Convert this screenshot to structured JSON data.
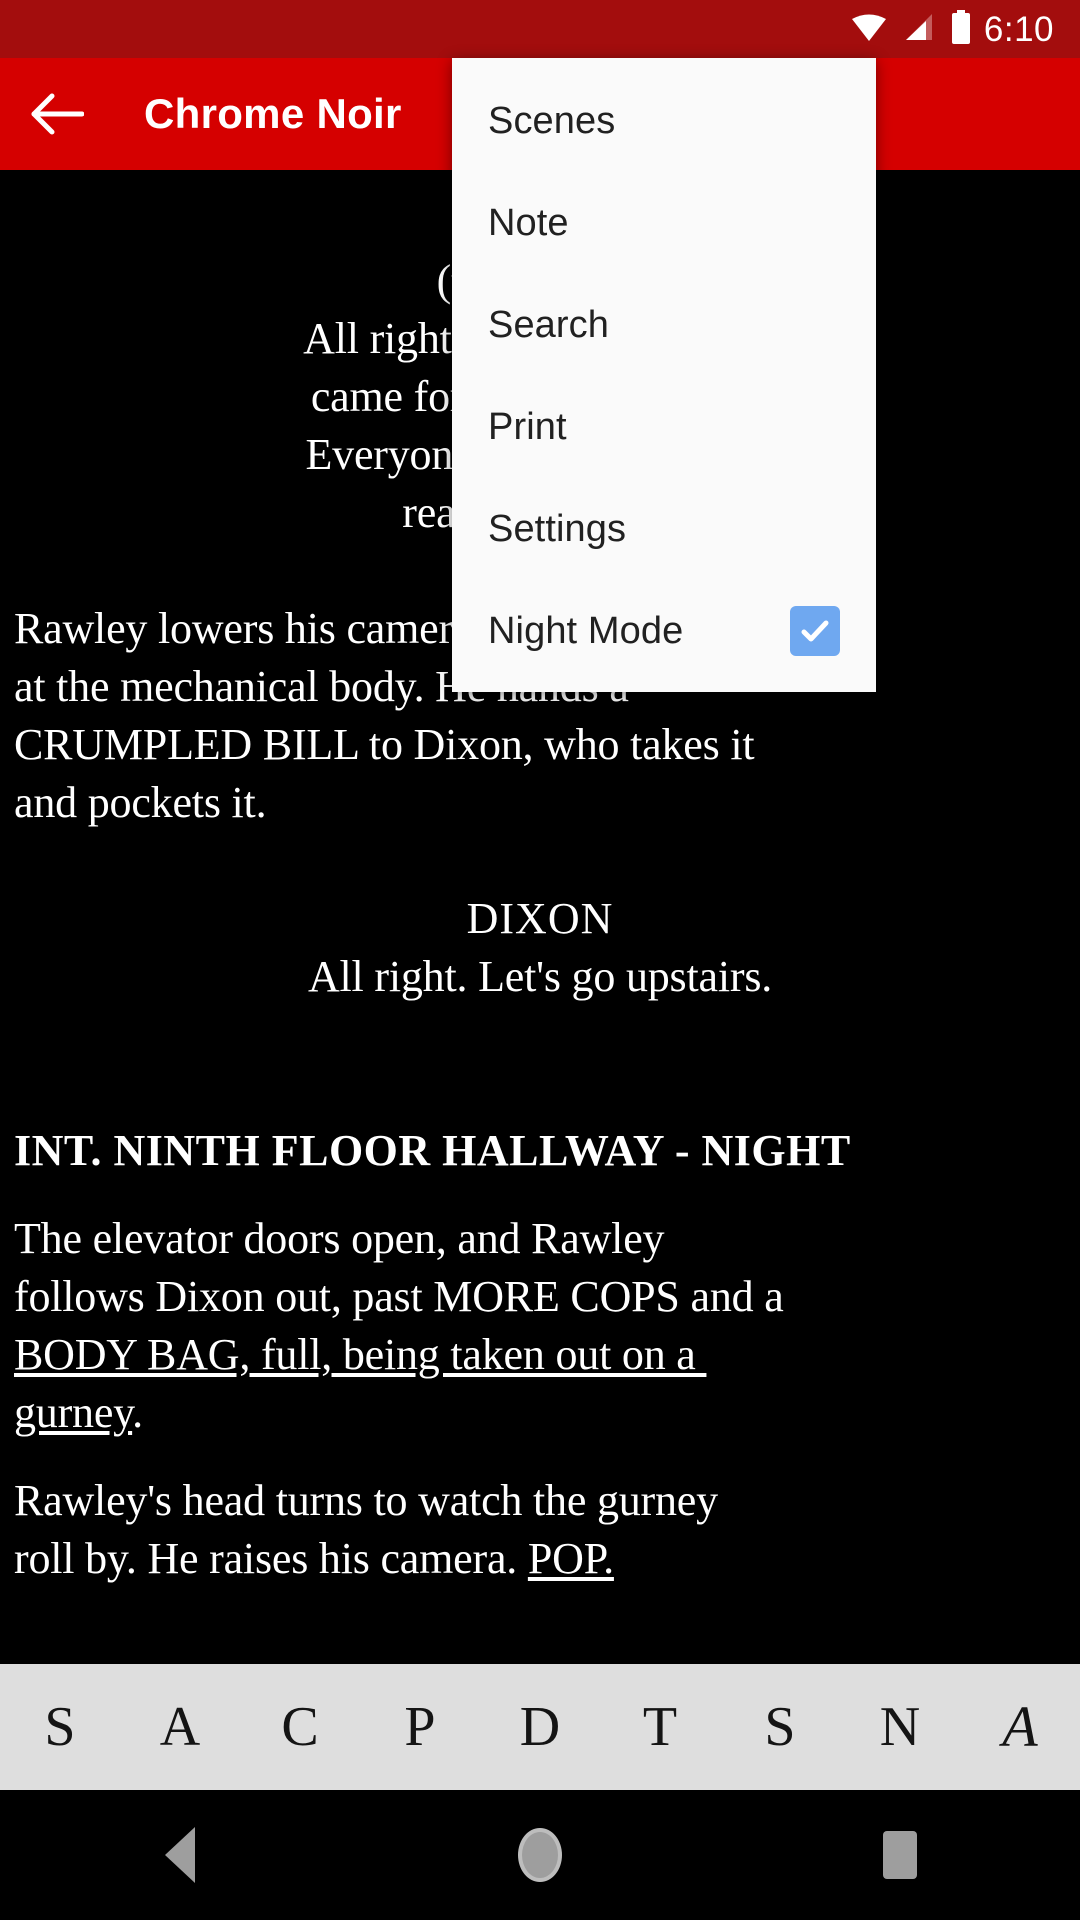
{
  "status_bar": {
    "clock": "6:10",
    "icons": [
      "wifi-icon",
      "signal-icon",
      "battery-icon"
    ],
    "background": "#a30d0d"
  },
  "app_bar": {
    "back_icon": "arrow-left-icon",
    "title": "Chrome Noir",
    "background": "#d50000",
    "title_color": "#ffffff"
  },
  "menu": {
    "background": "#fafafa",
    "text_color": "#212121",
    "items": [
      {
        "label": "Scenes",
        "type": "item",
        "checked": null
      },
      {
        "label": "Note",
        "type": "item",
        "checked": null
      },
      {
        "label": "Search",
        "type": "item",
        "checked": null
      },
      {
        "label": "Print",
        "type": "item",
        "checked": null
      },
      {
        "label": "Settings",
        "type": "item",
        "checked": null
      },
      {
        "label": "Night Mode",
        "type": "checkbox",
        "checked": true
      }
    ],
    "checkbox_color": "#6fa8f0",
    "checkmark_color": "#ffffff"
  },
  "script": {
    "background": "#000000",
    "text_color": "#ffffff",
    "blocks": [
      {
        "kind": "character",
        "text": "DIXON"
      },
      {
        "kind": "paren",
        "text": "(to Rawley)"
      },
      {
        "kind": "dialogue",
        "text": "All right, you got what you"
      },
      {
        "kind": "dialogue",
        "text": "came for, you can go now."
      },
      {
        "kind": "dialogue",
        "text": "Everyone with a badge has"
      },
      {
        "kind": "dialogue",
        "text": "real work to do."
      },
      {
        "kind": "blank",
        "text": ""
      },
      {
        "kind": "action",
        "text": "Rawley lowers his camera. He looks"
      },
      {
        "kind": "action",
        "text": "at the mechanical body. He hands a"
      },
      {
        "kind": "action",
        "text": "CRUMPLED BILL to Dixon, who takes it"
      },
      {
        "kind": "action",
        "text": "and pockets it."
      },
      {
        "kind": "blank",
        "text": ""
      },
      {
        "kind": "character",
        "text": "DIXON"
      },
      {
        "kind": "dialogue",
        "text": "All right. Let's go upstairs."
      },
      {
        "kind": "blank",
        "text": ""
      },
      {
        "kind": "blank",
        "text": ""
      },
      {
        "kind": "slug",
        "text": "INT. NINTH FLOOR HALLWAY - NIGHT"
      },
      {
        "kind": "halfblank",
        "text": ""
      },
      {
        "kind": "action",
        "text": "The elevator doors open, and Rawley"
      },
      {
        "kind": "action",
        "text": "follows Dixon out, past MORE COPS and a"
      },
      {
        "kind": "action_underline",
        "text": "BODY BAG, full, being taken out on a "
      },
      {
        "kind": "action_underline_partial",
        "text": "gurney",
        "tail": "."
      },
      {
        "kind": "halfblank",
        "text": ""
      },
      {
        "kind": "action",
        "text": "Rawley's head turns to watch the gurney"
      },
      {
        "kind": "action_tail_underline",
        "text": "roll by. He raises his camera. ",
        "underlined": "POP."
      }
    ]
  },
  "tag_bar": {
    "background": "#dedede",
    "keys": [
      {
        "label": "S",
        "name": "scene-key"
      },
      {
        "label": "A",
        "name": "action-key"
      },
      {
        "label": "C",
        "name": "character-key"
      },
      {
        "label": "P",
        "name": "parenthetical-key"
      },
      {
        "label": "D",
        "name": "dialogue-key"
      },
      {
        "label": "T",
        "name": "transition-key"
      },
      {
        "label": "S",
        "name": "shot-key"
      },
      {
        "label": "N",
        "name": "note-key"
      },
      {
        "label": "A",
        "name": "font-size-key",
        "style": "italic"
      }
    ]
  },
  "nav_bar": {
    "background": "#000000",
    "buttons": [
      {
        "name": "nav-back-button",
        "icon": "triangle-left-icon"
      },
      {
        "name": "nav-home-button",
        "icon": "circle-icon"
      },
      {
        "name": "nav-recents-button",
        "icon": "square-icon"
      }
    ]
  }
}
